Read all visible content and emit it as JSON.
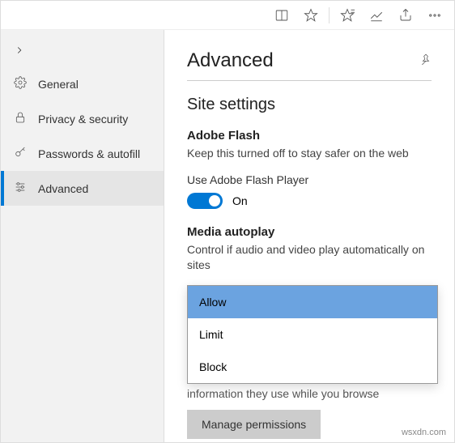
{
  "sidebar": {
    "items": [
      {
        "label": "General"
      },
      {
        "label": "Privacy & security"
      },
      {
        "label": "Passwords & autofill"
      },
      {
        "label": "Advanced"
      }
    ]
  },
  "header": {
    "title": "Advanced"
  },
  "siteSettings": {
    "title": "Site settings"
  },
  "flash": {
    "heading": "Adobe Flash",
    "desc": "Keep this turned off to stay safer on the web",
    "setting": "Use Adobe Flash Player",
    "state": "On"
  },
  "autoplay": {
    "heading": "Media autoplay",
    "desc": "Control if audio and video play automatically on sites",
    "options": [
      "Allow",
      "Limit",
      "Block"
    ],
    "underText": "information they use while you browse"
  },
  "manage": {
    "label": "Manage permissions"
  },
  "watermark": "wsxdn.com"
}
